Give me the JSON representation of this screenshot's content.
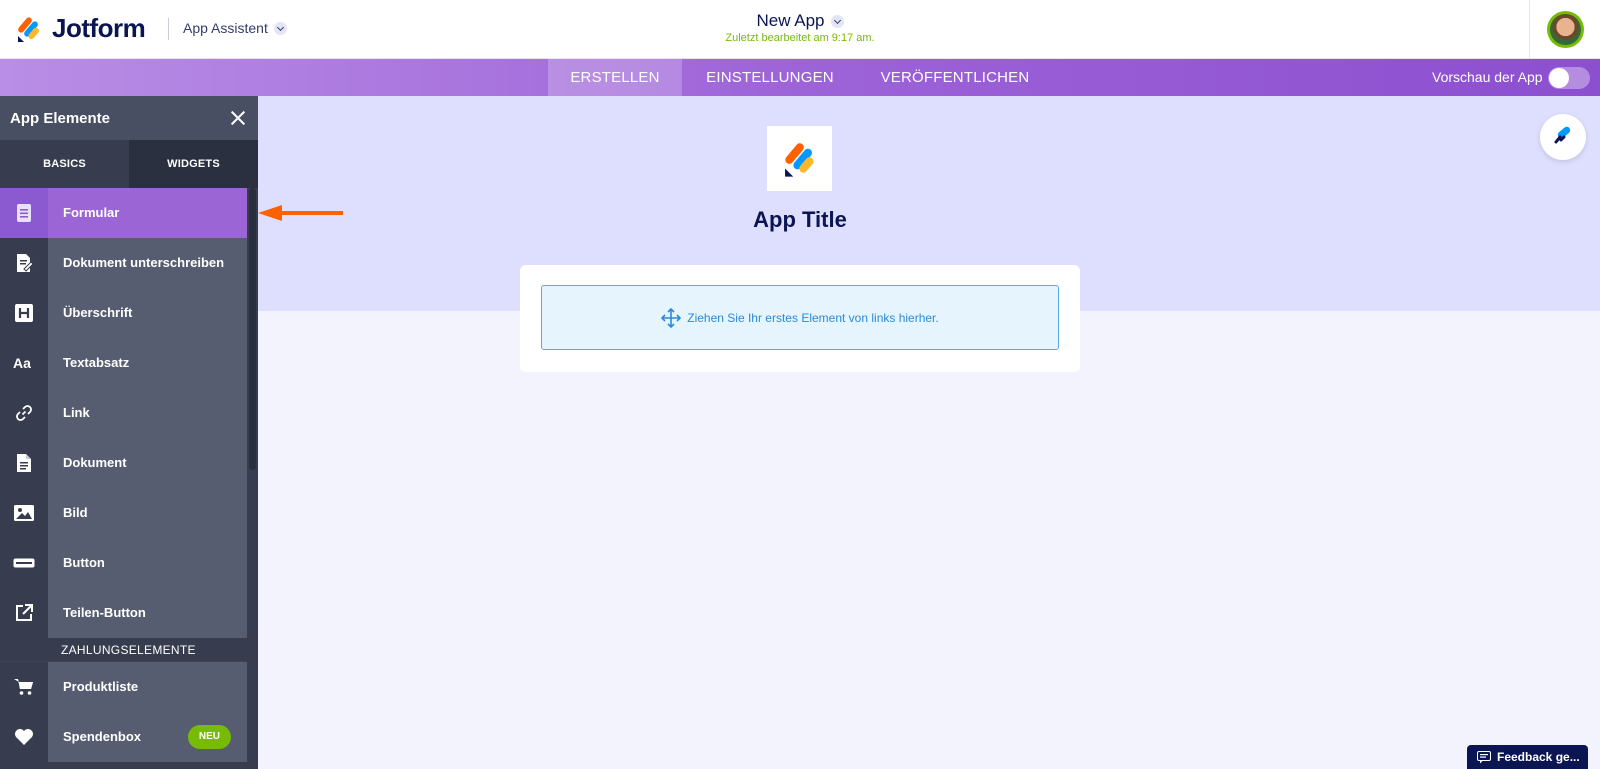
{
  "header": {
    "brand": "Jotform",
    "assistant_label": "App Assistent",
    "app_name": "New App",
    "last_edited": "Zuletzt bearbeitet am 9:17 am."
  },
  "nav": {
    "tabs": [
      "ERSTELLEN",
      "EINSTELLUNGEN",
      "VERÖFFENTLICHEN"
    ],
    "active_tab": "ERSTELLEN",
    "preview_label": "Vorschau der App",
    "preview_enabled": false
  },
  "panel": {
    "title": "App Elemente",
    "tabs": [
      "BASICS",
      "WIDGETS"
    ],
    "active_tab": "BASICS",
    "items": [
      {
        "label": "Formular",
        "icon": "form-icon",
        "selected": true
      },
      {
        "label": "Dokument unterschreiben",
        "icon": "sign-document-icon"
      },
      {
        "label": "Überschrift",
        "icon": "heading-icon"
      },
      {
        "label": "Textabsatz",
        "icon": "paragraph-icon"
      },
      {
        "label": "Link",
        "icon": "link-icon"
      },
      {
        "label": "Dokument",
        "icon": "document-icon"
      },
      {
        "label": "Bild",
        "icon": "image-icon"
      },
      {
        "label": "Button",
        "icon": "button-icon"
      },
      {
        "label": "Teilen-Button",
        "icon": "share-icon"
      }
    ],
    "section_label": "ZAHLUNGSELEMENTE",
    "payment_items": [
      {
        "label": "Produktliste",
        "icon": "cart-icon"
      },
      {
        "label": "Spendenbox",
        "icon": "heart-icon",
        "badge": "NEU"
      }
    ]
  },
  "canvas": {
    "app_title": "App Title",
    "dropzone_text": "Ziehen Sie Ihr erstes Element von links hierher."
  },
  "feedback_label": "Feedback ge...",
  "colors": {
    "accent_purple": "#9b65d6",
    "brand_navy": "#0a1551",
    "green": "#78bb07",
    "annotation_arrow": "#ff6100"
  }
}
